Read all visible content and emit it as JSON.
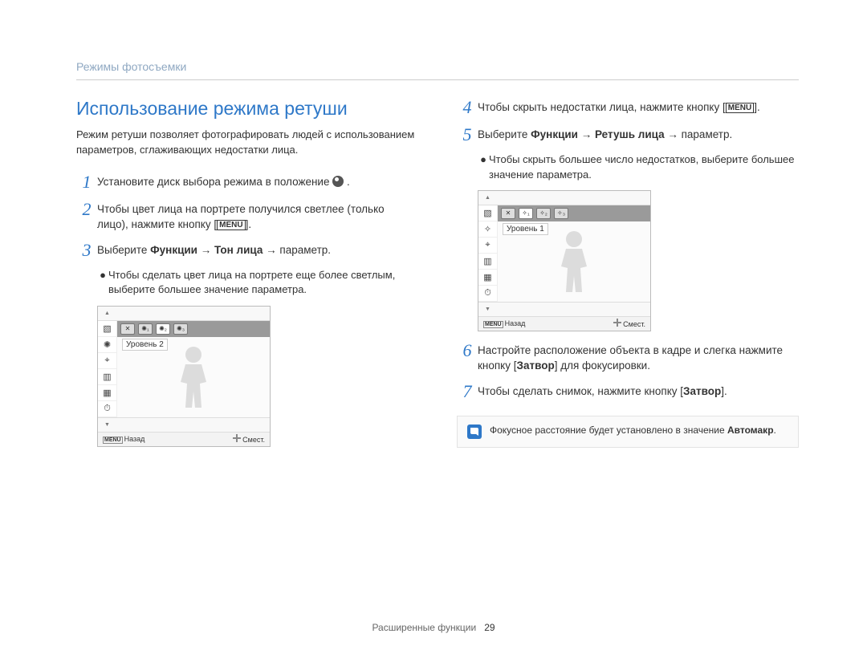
{
  "breadcrumb": "Режимы фотосъемки",
  "title": "Использование режима ретуши",
  "intro": "Режим ретуши позволяет фотографировать людей с использованием параметров, сглаживающих недостатки лица.",
  "steps": {
    "s1": {
      "num": "1",
      "text": "Установите диск выбора режима в положение "
    },
    "s2": {
      "num": "2",
      "text_a": "Чтобы цвет лица на портрете получился светлее (только лицо), нажмите кнопку [",
      "menu": "MENU",
      "text_b": "]."
    },
    "s3": {
      "num": "3",
      "prefix": "Выберите ",
      "b1": "Функции",
      "arrow": " → ",
      "b2": "Тон лица",
      "suffix": " → параметр.",
      "bullet": "Чтобы сделать цвет лица на портрете еще более светлым, выберите большее значение параметра."
    },
    "s4": {
      "num": "4",
      "text_a": "Чтобы скрыть недостатки лица, нажмите кнопку [",
      "menu": "MENU",
      "text_b": "]."
    },
    "s5": {
      "num": "5",
      "prefix": "Выберите ",
      "b1": "Функции",
      "arrow": " → ",
      "b2": "Ретушь лица",
      "suffix": " → параметр.",
      "bullet": "Чтобы скрыть большее число недостатков, выберите большее значение параметра."
    },
    "s6": {
      "num": "6",
      "text_a": "Настройте расположение объекта в кадре и слегка нажмите кнопку [",
      "b": "Затвор",
      "text_b": "] для фокусировки."
    },
    "s7": {
      "num": "7",
      "text_a": "Чтобы сделать снимок, нажмите кнопку [",
      "b": "Затвор",
      "text_b": "]."
    }
  },
  "lcd_left": {
    "level": "Уровень 2",
    "back_key": "MENU",
    "back": "Назад",
    "move": "Смест."
  },
  "lcd_right": {
    "level": "Уровень 1",
    "back_key": "MENU",
    "back": "Назад",
    "move": "Смест."
  },
  "note": {
    "text_a": "Фокусное расстояние будет установлено в значение ",
    "b": "Автомакр",
    "text_b": "."
  },
  "footer": {
    "section": "Расширенные функции",
    "page": "29"
  }
}
